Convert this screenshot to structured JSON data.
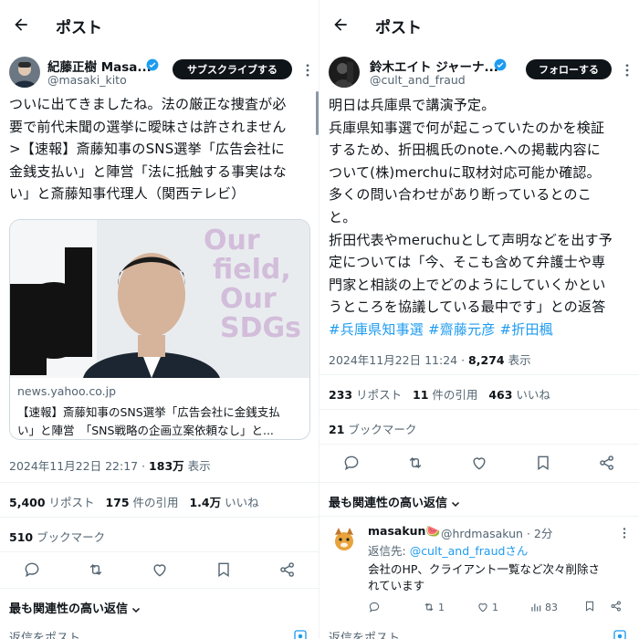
{
  "left": {
    "topbar": {
      "title": "ポスト"
    },
    "author": {
      "name": "紀藤正樹 Masa...",
      "handle": "@masaki_kito",
      "action_label": "サブスクライブする"
    },
    "body_lines": [
      "ついに出てきましたね。法の厳正な捜査が必",
      "要で前代未聞の選挙に曖昧さは許されません",
      ">【速報】斎藤知事のSNS選挙「広告会社に",
      "金銭支払い」と陣営「法に抵触する事実はな",
      "い」と斎藤知事代理人（関西テレビ）"
    ],
    "card": {
      "domain": "news.yahoo.co.jp",
      "title_lines": [
        "【速報】斎藤知事のSNS選挙「広告会社に金銭支払",
        "い」と陣営　「SNS戦略の企画立案依頼なし」と..."
      ],
      "thumb_text": [
        "Our",
        "field,",
        "Our",
        "SDGs"
      ]
    },
    "meta": {
      "timestamp": "2024年11月22日 22:17 · ",
      "views": "183万",
      "views_label": " 表示"
    },
    "stats": {
      "reposts": "5,400",
      "reposts_label": " リポスト",
      "quotes": "175",
      "quotes_label": " 件の引用",
      "likes": "1.4万",
      "likes_label": " いいね",
      "bookmarks": "510",
      "bookmarks_label": " ブックマーク"
    },
    "relevance_label": "最も関連性の高い返信",
    "reply_placeholder": "返信をポスト"
  },
  "right": {
    "topbar": {
      "title": "ポスト"
    },
    "author": {
      "name": "鈴木エイト ジャーナ...",
      "handle": "@cult_and_fraud",
      "action_label": "フォローする"
    },
    "body_lines": [
      "明日は兵庫県で講演予定。",
      "兵庫県知事選で何が起こっていたのかを検証",
      "するため、折田楓氏のnote.への掲載内容に",
      "ついて(株)merchuに取材対応可能か確認。",
      "多くの問い合わせがあり断っているとのこ",
      "と。",
      "折田代表やmeruchuとして声明などを出す予",
      "定については「今、そこも含めて弁護士や専",
      "門家と相談の上でどのようにしていくかとい",
      "うところを協議している最中です」との返答"
    ],
    "hashtags": [
      "#兵庫県知事選",
      "#齋藤元彦",
      "#折田楓"
    ],
    "meta": {
      "timestamp": "2024年11月22日 11:24 · ",
      "views": "8,274",
      "views_label": " 表示"
    },
    "stats": {
      "reposts": "233",
      "reposts_label": " リポスト",
      "quotes": "11",
      "quotes_label": " 件の引用",
      "likes": "463",
      "likes_label": " いいね",
      "bookmarks": "21",
      "bookmarks_label": " ブックマーク"
    },
    "relevance_label": "最も関連性の高い返信",
    "reply": {
      "name": "masakun🍉",
      "handle": "@hrdmasakun · 2分",
      "reply_to_label": "返信先: ",
      "reply_to_handle": "@cult_and_fraudさん",
      "text_lines": [
        "会社のHP、クライアント一覧など次々削除さ",
        "れています"
      ],
      "retweets": "1",
      "likes": "1",
      "views": "83"
    },
    "reply_placeholder": "返信をポスト"
  },
  "colors": {
    "accent": "#1d9bf0",
    "text": "#0f1419",
    "muted": "#536471",
    "border": "#eff3f4"
  }
}
